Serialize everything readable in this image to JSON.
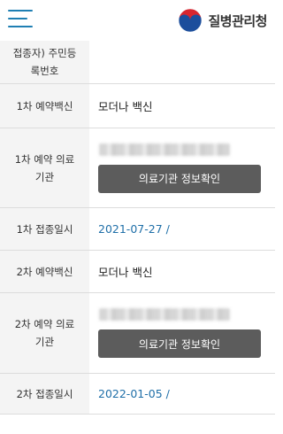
{
  "header": {
    "logo_text": "질병관리청",
    "menu_icon": "hamburger-menu-icon",
    "logo_icon": "taegeuk-logo-icon",
    "accent_color": "#1f7fb3"
  },
  "table": {
    "rows": [
      {
        "label": "접종자) 주민등\n록번호",
        "value": ""
      },
      {
        "label": "1차 예약백신",
        "value": "모더나 백신"
      },
      {
        "label": "1차 예약 의료\n기관",
        "button": "의료기관 정보확인"
      },
      {
        "label": "1차 접종일시",
        "value": "2021-07-27 /"
      },
      {
        "label": "2차 예약백신",
        "value": "모더나 백신"
      },
      {
        "label": "2차 예약 의료\n기관",
        "button": "의료기관 정보확인"
      },
      {
        "label": "2차 접종일시",
        "value": "2022-01-05 /"
      }
    ]
  }
}
